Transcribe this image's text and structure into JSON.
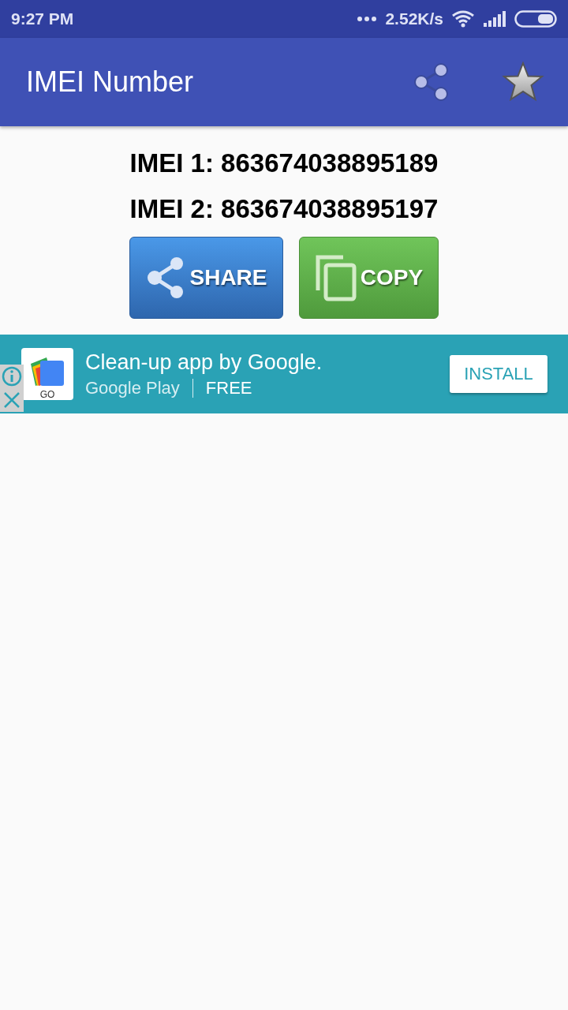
{
  "status_bar": {
    "time": "9:27 PM",
    "speed": "2.52K/s"
  },
  "app_bar": {
    "title": "IMEI Number"
  },
  "imei": [
    "IMEI 1: 863674038895189",
    "IMEI 2: 863674038895197"
  ],
  "buttons": [
    {
      "kind": "share",
      "label": "SHARE"
    },
    {
      "kind": "copy",
      "label": "COPY"
    }
  ],
  "ad": {
    "app_icon_label": "GO",
    "headline": "Clean-up app by Google.",
    "store": "Google Play",
    "price": "FREE",
    "action": "INSTALL"
  }
}
